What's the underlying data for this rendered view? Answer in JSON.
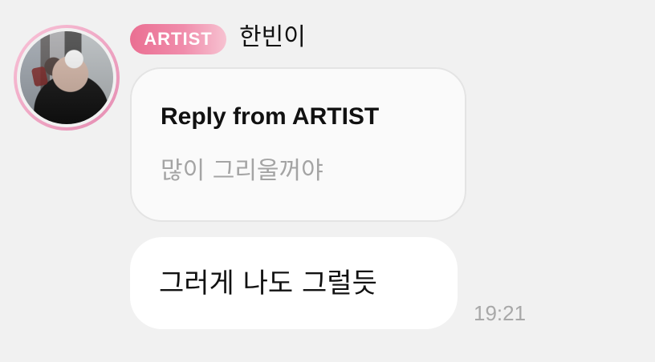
{
  "message": {
    "badge_label": "ARTIST",
    "sender_name": "한빈이",
    "reply_title": "Reply from ARTIST",
    "reply_text": "많이 그리울꺼야",
    "message_text": "그러게 나도 그럴듯",
    "timestamp": "19:21"
  },
  "colors": {
    "background": "#f1f1f1",
    "badge_gradient_start": "#ea6f92",
    "badge_gradient_end": "#f7c2d1",
    "reply_bubble": "#fafafa",
    "message_bubble": "#ffffff",
    "secondary_text": "#a4a4a4"
  }
}
